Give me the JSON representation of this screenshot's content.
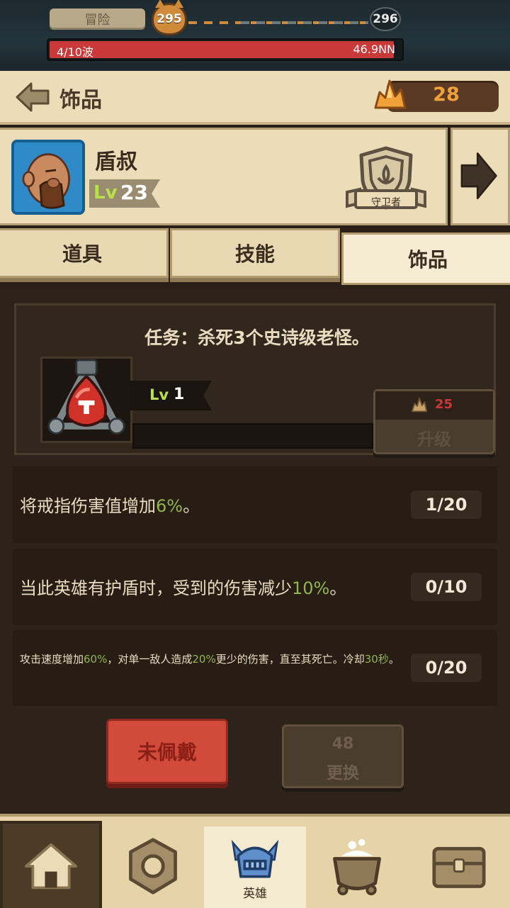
{
  "hud": {
    "mode_label": "冒险",
    "current_stage": "295",
    "next_stage": "296",
    "wave_text": "4/10波",
    "enemy_hp": "46.9NN",
    "wave_progress": 0.98
  },
  "header": {
    "title": "饰品",
    "crystals": "28"
  },
  "hero": {
    "name": "盾叔",
    "lv_label": "Lv",
    "level": "23",
    "class_name": "守卫者"
  },
  "tabs": {
    "items": "道具",
    "skills": "技能",
    "trinket": "饰品",
    "active": "trinket"
  },
  "trinket": {
    "mission": "任务：杀死3个史诗级老怪。",
    "lv_label": "Lv",
    "level": "1",
    "upgrade_cost": "25",
    "upgrade_label": "升级",
    "xp_progress": 0.0
  },
  "perks": [
    {
      "pre": "将戒指伤害值增加",
      "hl": "6%",
      "post": "。",
      "count": "1/20"
    },
    {
      "pre": "当此英雄有护盾时，受到的伤害减少",
      "hl": "10%",
      "post": "。",
      "count": "0/10"
    },
    {
      "pre": "攻击速度增加",
      "hl": "60%",
      "mid": "，对单一敌人造成",
      "hl2": "20%",
      "mid2": "更少的伤害，直至其死亡。冷却",
      "hl3": "30秒",
      "post": "。",
      "count": "0/20"
    }
  ],
  "buttons": {
    "unequip": "未佩戴",
    "change_cost": "48",
    "change": "更换"
  },
  "nav": {
    "hero_label": "英雄"
  },
  "colors": {
    "accent_green": "#8fb64a",
    "danger_red": "#c9393a",
    "crystal_orange": "#f0a13a",
    "portrait_blue": "#2f8bc7"
  },
  "icons": [
    "back-arrow-icon",
    "crystal-icon",
    "next-arrow-icon",
    "guardian-shield-icon",
    "trinket-icon",
    "crystal-small-icon",
    "home-icon",
    "gear-icon",
    "hero-helmet-icon",
    "cauldron-icon",
    "chest-icon"
  ]
}
